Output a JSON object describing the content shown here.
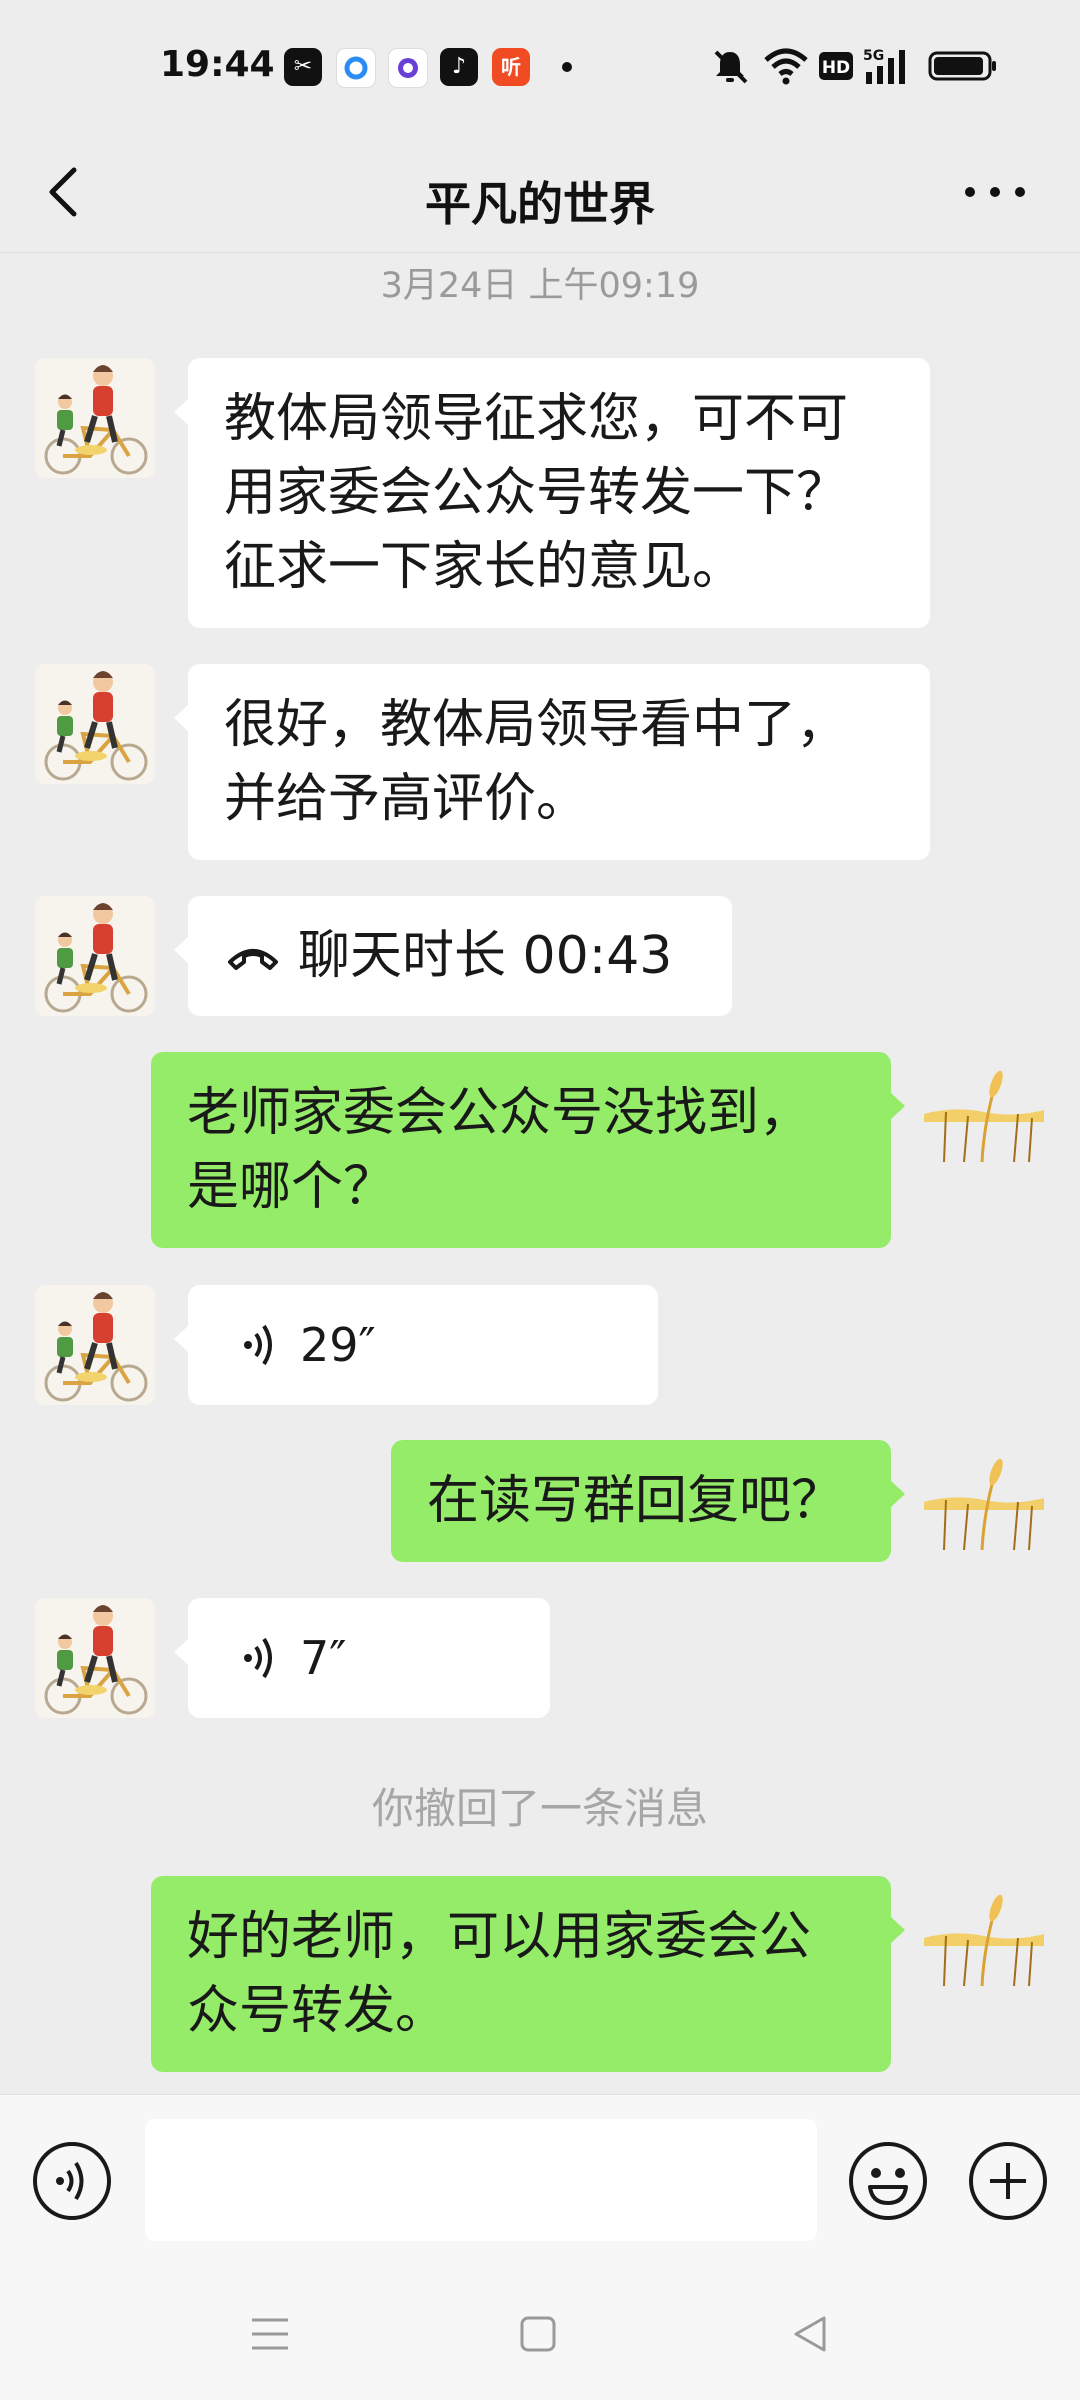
{
  "status_bar": {
    "time": "19:44",
    "notification_icons": [
      "capcut-icon",
      "circle-app-icon",
      "purple-app-icon",
      "tiktok-icon",
      "ting-app-icon"
    ],
    "ting_label": "听",
    "hd_label": "HD",
    "network_label": "5G",
    "battery_level": 0.95
  },
  "nav": {
    "title": "平凡的世界",
    "back_icon": "chevron-left-icon",
    "more_icon": "more-dots-icon"
  },
  "chat": {
    "timestamp": "3月24日 上午09:19",
    "messages": [
      {
        "from": "other",
        "type": "text",
        "text": "教体局领导征求您，可不可用家委会公众号转发一下？征求一下家长的意见。"
      },
      {
        "from": "other",
        "type": "text",
        "text": "很好，教体局领导看中了，并给予高评价。"
      },
      {
        "from": "other",
        "type": "call",
        "text": "聊天时长 00:43",
        "icon": "phone-hangup-icon"
      },
      {
        "from": "me",
        "type": "text",
        "text": "老师家委会公众号没找到，是哪个？"
      },
      {
        "from": "other",
        "type": "voice",
        "text": "29″",
        "icon": "voice-wave-icon"
      },
      {
        "from": "me",
        "type": "text",
        "text": "在读写群回复吧？"
      },
      {
        "from": "other",
        "type": "voice",
        "text": "7″",
        "icon": "voice-wave-icon"
      },
      {
        "from": "me",
        "type": "text",
        "text": "好的老师，可以用家委会公众号转发。"
      }
    ],
    "recall_notice": "你撤回了一条消息"
  },
  "input_bar": {
    "voice_icon": "voice-input-icon",
    "emoji_icon": "emoji-icon",
    "plus_icon": "plus-circle-icon",
    "text_value": ""
  },
  "colors": {
    "background": "#ededed",
    "outgoing_bubble": "#95ec69",
    "incoming_bubble": "#ffffff"
  }
}
